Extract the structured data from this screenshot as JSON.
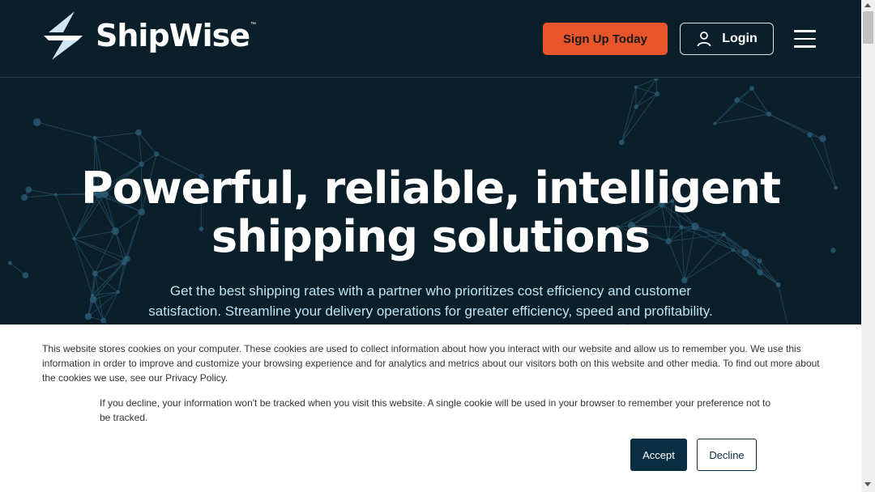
{
  "brand": {
    "name": "ShipWise",
    "tm": "™",
    "logo_icon": "lightning-bolt-icon"
  },
  "header": {
    "signup_label": "Sign Up Today",
    "login_label": "Login",
    "login_icon": "user-icon",
    "menu_icon": "hamburger-menu-icon"
  },
  "hero": {
    "title_line1": "Powerful, reliable, intelligent",
    "title_line2": "shipping solutions",
    "subtitle_line1": "Get the best shipping rates with a partner who prioritizes cost efficiency and customer",
    "subtitle_line2": "satisfaction. Streamline your delivery operations for greater efficiency, speed and profitability."
  },
  "cookie_banner": {
    "paragraph1": "This website stores cookies on your computer. These cookies are used to collect information about how you interact with our website and allow us to remember you. We use this information in order to improve and customize your browsing experience and for analytics and metrics about our visitors both on this website and other media. To find out more about the cookies we use, see our Privacy Policy.",
    "paragraph2": "If you decline, your information won't be tracked when you visit this website. A single cookie will be used in your browser to remember your preference not to be tracked.",
    "accept_label": "Accept",
    "decline_label": "Decline"
  },
  "colors": {
    "background": "#0b1f2b",
    "accent_orange": "#e8552a",
    "subtitle_blue": "#bfe3f4",
    "button_dark": "#0b2d42"
  }
}
